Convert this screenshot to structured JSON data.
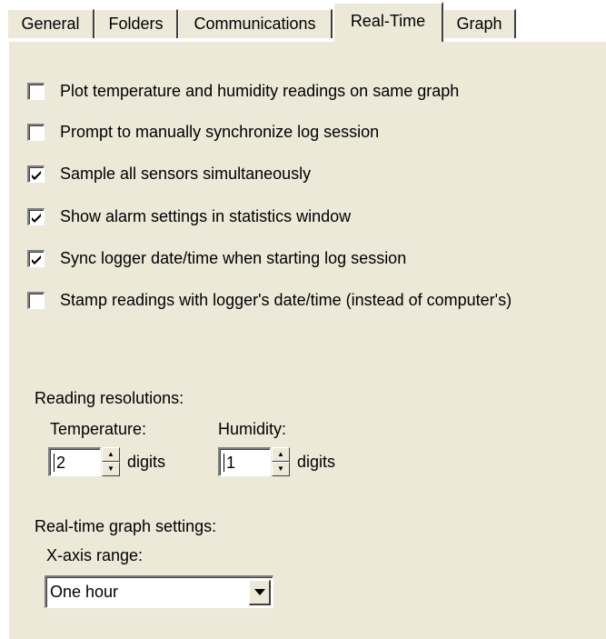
{
  "tabs": [
    {
      "label": "General"
    },
    {
      "label": "Folders"
    },
    {
      "label": "Communications"
    },
    {
      "label": "Real-Time",
      "active": true
    },
    {
      "label": "Graph"
    }
  ],
  "options": [
    {
      "label": "Plot temperature and humidity readings on same graph",
      "checked": false
    },
    {
      "label": "Prompt to manually synchronize log session",
      "checked": false
    },
    {
      "label": "Sample all sensors simultaneously",
      "checked": true
    },
    {
      "label": "Show alarm settings in statistics window",
      "checked": true
    },
    {
      "label": "Sync logger date/time when starting log session",
      "checked": true
    },
    {
      "label": "Stamp readings with logger's date/time (instead of computer's)",
      "checked": false
    }
  ],
  "resolutions": {
    "heading": "Reading resolutions:",
    "temperature": {
      "label": "Temperature:",
      "value": "2",
      "unit": "digits"
    },
    "humidity": {
      "label": "Humidity:",
      "value": "1",
      "unit": "digits"
    }
  },
  "graph_settings": {
    "heading": "Real-time graph settings:",
    "xaxis_label": "X-axis range:",
    "xaxis_value": "One hour"
  },
  "icons": {
    "check": "checkmark-icon",
    "spin_up": "arrow-up-icon",
    "spin_down": "arrow-down-icon",
    "dropdown": "chevron-down-icon"
  }
}
